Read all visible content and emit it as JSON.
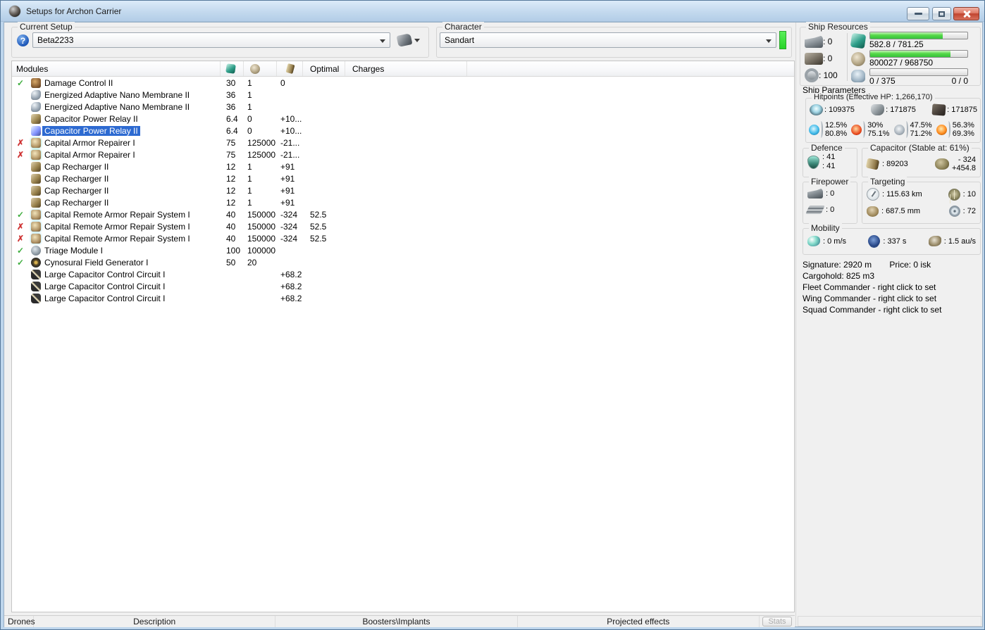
{
  "window": {
    "title": "Setups for Archon Carrier"
  },
  "setup": {
    "label": "Current Setup",
    "value": "Beta2233"
  },
  "character": {
    "label": "Character",
    "value": "Sandart"
  },
  "table": {
    "header": {
      "modules": "Modules",
      "optimal": "Optimal",
      "charges": "Charges"
    },
    "rows": [
      {
        "status": "ok",
        "icon": "damage-control",
        "name": "Damage Control II",
        "cpu": "30",
        "grid": "1",
        "cap": "0",
        "optimal": "",
        "charges": "",
        "selected": false
      },
      {
        "status": "",
        "icon": "nano-membrane",
        "name": "Energized Adaptive Nano Membrane II",
        "cpu": "36",
        "grid": "1",
        "cap": "",
        "optimal": "",
        "charges": "",
        "selected": false
      },
      {
        "status": "",
        "icon": "nano-membrane",
        "name": "Energized Adaptive Nano Membrane II",
        "cpu": "36",
        "grid": "1",
        "cap": "",
        "optimal": "",
        "charges": "",
        "selected": false
      },
      {
        "status": "",
        "icon": "cap-power-relay",
        "name": "Capacitor Power Relay II",
        "cpu": "6.4",
        "grid": "0",
        "cap": "+10...",
        "optimal": "",
        "charges": "",
        "selected": false
      },
      {
        "status": "",
        "icon": "cap-power-relay",
        "name": "Capacitor Power Relay II",
        "cpu": "6.4",
        "grid": "0",
        "cap": "+10...",
        "optimal": "",
        "charges": "",
        "selected": true
      },
      {
        "status": "bad",
        "icon": "armor-repairer",
        "name": "Capital Armor Repairer I",
        "cpu": "75",
        "grid": "125000",
        "cap": "-21...",
        "optimal": "",
        "charges": "",
        "selected": false
      },
      {
        "status": "bad",
        "icon": "armor-repairer",
        "name": "Capital Armor Repairer I",
        "cpu": "75",
        "grid": "125000",
        "cap": "-21...",
        "optimal": "",
        "charges": "",
        "selected": false
      },
      {
        "status": "",
        "icon": "cap-recharger",
        "name": "Cap Recharger II",
        "cpu": "12",
        "grid": "1",
        "cap": "+91",
        "optimal": "",
        "charges": "",
        "selected": false
      },
      {
        "status": "",
        "icon": "cap-recharger",
        "name": "Cap Recharger II",
        "cpu": "12",
        "grid": "1",
        "cap": "+91",
        "optimal": "",
        "charges": "",
        "selected": false
      },
      {
        "status": "",
        "icon": "cap-recharger",
        "name": "Cap Recharger II",
        "cpu": "12",
        "grid": "1",
        "cap": "+91",
        "optimal": "",
        "charges": "",
        "selected": false
      },
      {
        "status": "",
        "icon": "cap-recharger",
        "name": "Cap Recharger II",
        "cpu": "12",
        "grid": "1",
        "cap": "+91",
        "optimal": "",
        "charges": "",
        "selected": false
      },
      {
        "status": "ok",
        "icon": "remote-repairer",
        "name": "Capital Remote Armor Repair System I",
        "cpu": "40",
        "grid": "150000",
        "cap": "-324",
        "optimal": "52.5",
        "charges": "",
        "selected": false
      },
      {
        "status": "bad",
        "icon": "remote-repairer",
        "name": "Capital Remote Armor Repair System I",
        "cpu": "40",
        "grid": "150000",
        "cap": "-324",
        "optimal": "52.5",
        "charges": "",
        "selected": false
      },
      {
        "status": "bad",
        "icon": "remote-repairer",
        "name": "Capital Remote Armor Repair System I",
        "cpu": "40",
        "grid": "150000",
        "cap": "-324",
        "optimal": "52.5",
        "charges": "",
        "selected": false
      },
      {
        "status": "ok",
        "icon": "triage",
        "name": "Triage Module I",
        "cpu": "100",
        "grid": "100000",
        "cap": "",
        "optimal": "",
        "charges": "",
        "selected": false
      },
      {
        "status": "ok",
        "icon": "cyno",
        "name": "Cynosural Field Generator I",
        "cpu": "50",
        "grid": "20",
        "cap": "",
        "optimal": "",
        "charges": "",
        "selected": false
      },
      {
        "status": "",
        "icon": "rig",
        "name": "Large Capacitor Control Circuit I",
        "cpu": "",
        "grid": "",
        "cap": "+68.2",
        "optimal": "",
        "charges": "",
        "selected": false
      },
      {
        "status": "",
        "icon": "rig",
        "name": "Large Capacitor Control Circuit I",
        "cpu": "",
        "grid": "",
        "cap": "+68.2",
        "optimal": "",
        "charges": "",
        "selected": false
      },
      {
        "status": "",
        "icon": "rig",
        "name": "Large Capacitor Control Circuit I",
        "cpu": "",
        "grid": "",
        "cap": "+68.2",
        "optimal": "",
        "charges": "",
        "selected": false
      }
    ]
  },
  "resources": {
    "label": "Ship Resources",
    "turrets": "0",
    "launchers": "0",
    "calibration": "100",
    "cpu": {
      "text": "582.8 / 781.25",
      "pct": 74.6
    },
    "powergrid": {
      "text": "800027 / 968750",
      "pct": 82.6
    },
    "drones": {
      "text": "0 / 375",
      "bandwidth": "0 / 0",
      "pct": 0
    }
  },
  "parameters": {
    "label": "Ship Parameters",
    "hitpoints": {
      "label": "Hitpoints (Effective HP: 1,266,170)",
      "shield": "109375",
      "armor": "171875",
      "hull": "171875",
      "resists": {
        "em": {
          "top": "12.5%",
          "bottom": "80.8%"
        },
        "thermal": {
          "top": "30%",
          "bottom": "75.1%"
        },
        "kinetic": {
          "top": "47.5%",
          "bottom": "71.2%"
        },
        "explosive": {
          "top": "56.3%",
          "bottom": "69.3%"
        }
      }
    },
    "defence": {
      "label": "Defence",
      "top": "41",
      "bottom": "41"
    },
    "capacitor": {
      "label": "Capacitor (Stable at: 61%)",
      "amount": "89203",
      "drain": "- 324",
      "recharge": "+454.8"
    },
    "firepower": {
      "label": "Firepower",
      "turret": "0",
      "missile": "0"
    },
    "targeting": {
      "label": "Targeting",
      "range": "115.63 km",
      "sensor_strength": "10",
      "signature_resolution": "687.5 mm",
      "max_targets": "72"
    },
    "mobility": {
      "label": "Mobility",
      "speed": "0 m/s",
      "align_time": "337 s",
      "warp_speed": "1.5 au/s"
    }
  },
  "info": {
    "signature": "Signature: 2920 m",
    "price": "Price: 0 isk",
    "cargohold": "Cargohold: 825 m3",
    "fleet": "Fleet Commander - right click to set",
    "wing": "Wing Commander - right click to set",
    "squad": "Squad Commander - right click to set"
  },
  "bottom": {
    "drones": "Drones",
    "description": "Description",
    "boosters": "Boosters\\Implants",
    "projected": "Projected effects",
    "stats": "Stats"
  },
  "colors": {
    "accent_selection": "#2d6ad1",
    "resource_bar": "#35c23a",
    "ok": "#3fae3f",
    "bad": "#cf3434"
  }
}
